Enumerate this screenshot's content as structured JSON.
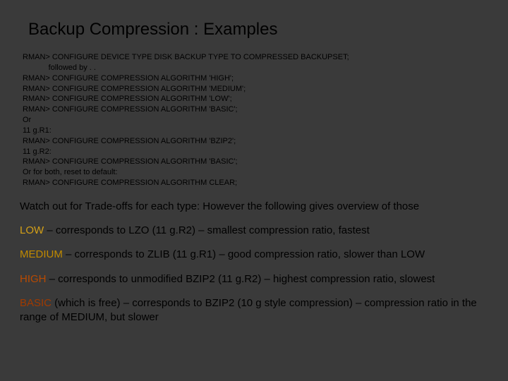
{
  "title": "Backup Compression : Examples",
  "code": {
    "l1": "RMAN> CONFIGURE DEVICE TYPE DISK BACKUP TYPE TO COMPRESSED BACKUPSET;",
    "l2": "            followed by . .",
    "l3": "RMAN> CONFIGURE COMPRESSION ALGORITHM 'HIGH';",
    "l4": "RMAN> CONFIGURE COMPRESSION ALGORITHM 'MEDIUM';",
    "l5": "RMAN> CONFIGURE COMPRESSION ALGORITHM 'LOW';",
    "l6": "RMAN> CONFIGURE COMPRESSION ALGORITHM 'BASIC';",
    "l7": "Or",
    "l8": "11 g.R1:",
    "l9": "RMAN> CONFIGURE COMPRESSION ALGORITHM 'BZIP2';",
    "l10": "11 g.R2:",
    "l11": "RMAN> CONFIGURE COMPRESSION ALGORITHM 'BASIC';",
    "l12": "Or for both, reset to default:",
    "l13": "RMAN> CONFIGURE COMPRESSION ALGORITHM CLEAR;"
  },
  "intro": "Watch out for Trade-offs for each type: However the following gives overview of those",
  "levels": {
    "low": {
      "label": "LOW",
      "desc": " – corresponds to LZO (11 g.R2) – smallest compression ratio, fastest"
    },
    "medium": {
      "label": "MEDIUM",
      "desc": " – corresponds to ZLIB (11 g.R1) – good compression ratio, slower than LOW"
    },
    "high": {
      "label": "HIGH",
      "desc": " – corresponds to unmodified BZIP2 (11 g.R2) – highest compression ratio, slowest"
    },
    "basic": {
      "label": "BASIC",
      "desc": " (which is free) – corresponds to BZIP2 (10 g style compression) – compression ratio in the range of MEDIUM, but slower"
    }
  }
}
